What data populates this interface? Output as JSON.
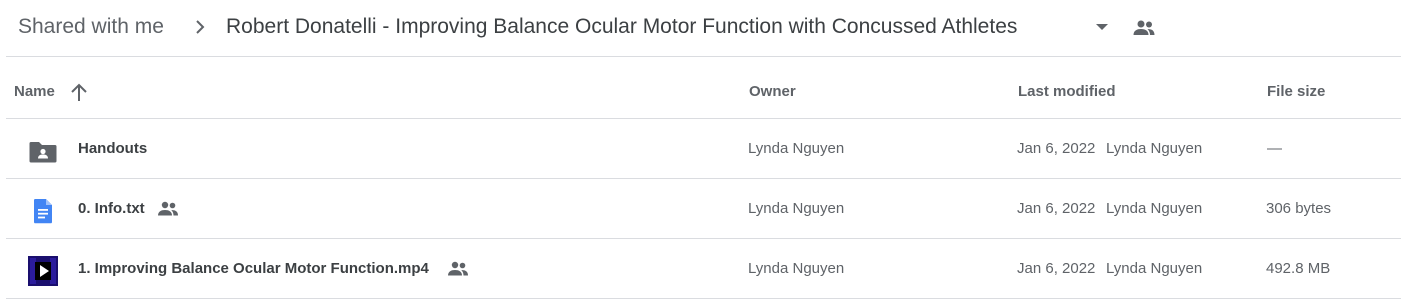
{
  "breadcrumb": {
    "root": "Shared with me",
    "current": "Robert Donatelli - Improving Balance Ocular Motor Function with Concussed Athletes"
  },
  "columns": {
    "name": "Name",
    "owner": "Owner",
    "modified": "Last modified",
    "size": "File size"
  },
  "rows": [
    {
      "name": "Handouts",
      "type": "shared-folder",
      "owner": "Lynda Nguyen",
      "modified_date": "Jan 6, 2022",
      "modified_by": "Lynda Nguyen",
      "size": "—",
      "shared": false
    },
    {
      "name": "0. Info.txt",
      "type": "document",
      "owner": "Lynda Nguyen",
      "modified_date": "Jan 6, 2022",
      "modified_by": "Lynda Nguyen",
      "size": "306 bytes",
      "shared": true
    },
    {
      "name": "1. Improving Balance  Ocular Motor Function.mp4",
      "type": "video",
      "owner": "Lynda Nguyen",
      "modified_date": "Jan 6, 2022",
      "modified_by": "Lynda Nguyen",
      "size": "492.8 MB",
      "shared": true
    }
  ],
  "colors": {
    "text_primary": "#3c4043",
    "text_secondary": "#5f6368",
    "divider": "#dadce0",
    "doc_blue": "#4285f4",
    "folder_gray": "#5f6368"
  },
  "icons": {
    "breadcrumb_separator": "chevron-right-icon",
    "breadcrumb_menu": "arrow-drop-down-icon",
    "shared": "people-icon",
    "sort": "arrow-upward-icon"
  }
}
